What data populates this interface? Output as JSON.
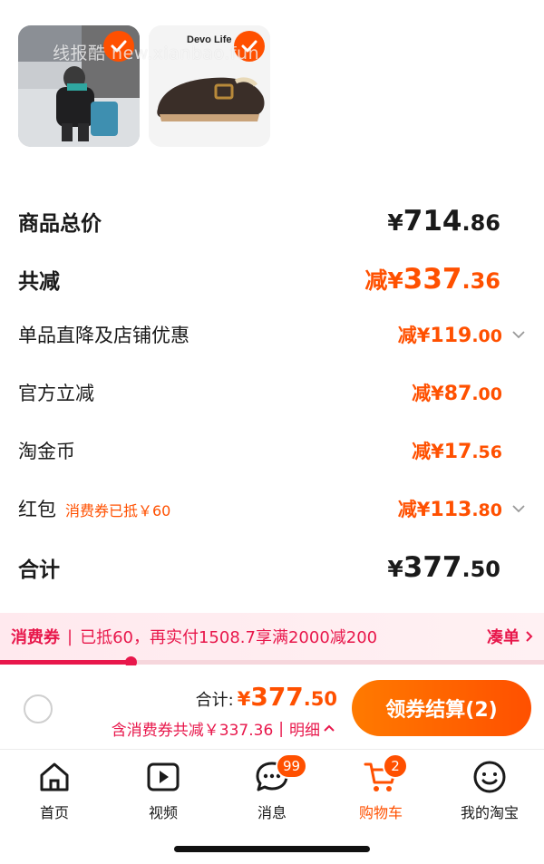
{
  "products": [
    {
      "name": "product-thumb-1",
      "selected": true
    },
    {
      "name": "product-thumb-2",
      "selected": true,
      "brand": "Devo Life"
    }
  ],
  "watermark": "线报酷 new.xianbao.fun",
  "summary": {
    "total_price": {
      "label": "商品总价",
      "prefix": "¥",
      "int": "714",
      "dec": ".86"
    },
    "total_reduction": {
      "label": "共减",
      "prefix": "减¥",
      "int": "337",
      "dec": ".36"
    },
    "store_discount": {
      "label": "单品直降及店铺优惠",
      "prefix": "减¥",
      "int": "119",
      "dec": ".00"
    },
    "official_discount": {
      "label": "官方立减",
      "prefix": "减¥",
      "int": "87",
      "dec": ".00"
    },
    "taojin_coin": {
      "label": "淘金币",
      "prefix": "减¥",
      "int": "17",
      "dec": ".56"
    },
    "red_packet": {
      "label": "红包",
      "note": "消费券已抵￥60",
      "prefix": "减¥",
      "int": "113",
      "dec": ".80"
    },
    "grand_total": {
      "label": "合计",
      "prefix": "¥",
      "int": "377",
      "dec": ".50"
    }
  },
  "voucher": {
    "tag": "消费券",
    "separator": "|",
    "message": "已抵60，再实付1508.7享满2000减200",
    "action": "凑单",
    "progress": 0.24
  },
  "checkout": {
    "total_label": "合计:",
    "total_yen": "¥",
    "total_int": "377",
    "total_dec": ".50",
    "savings_text": "含消费券共减￥337.36",
    "divider": "|",
    "detail_label": "明细",
    "button_label": "领券结算(2)"
  },
  "tabs": [
    {
      "label": "首页",
      "icon": "home-icon"
    },
    {
      "label": "视频",
      "icon": "video-icon"
    },
    {
      "label": "消息",
      "icon": "message-icon",
      "badge": "99"
    },
    {
      "label": "购物车",
      "icon": "cart-icon",
      "badge": "2",
      "active": true
    },
    {
      "label": "我的淘宝",
      "icon": "profile-icon"
    }
  ],
  "colors": {
    "accent": "#ff5000",
    "voucher": "#e8174b"
  }
}
